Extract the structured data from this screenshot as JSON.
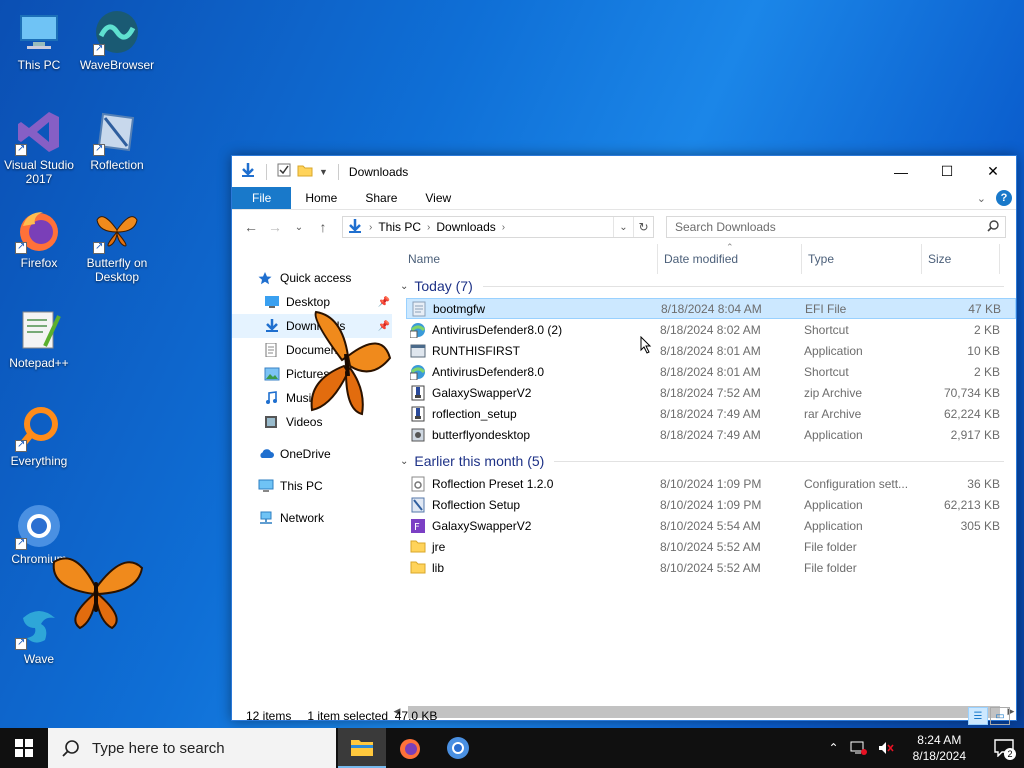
{
  "desktop": {
    "icons": [
      {
        "label": "This PC"
      },
      {
        "label": "WaveBrowser"
      },
      {
        "label": "Visual Studio 2017"
      },
      {
        "label": "Roflection"
      },
      {
        "label": "Firefox"
      },
      {
        "label": "Butterfly on Desktop"
      },
      {
        "label": "Notepad++"
      },
      {
        "label": "Everything"
      },
      {
        "label": "Chromium"
      },
      {
        "label": "Wave"
      }
    ]
  },
  "window": {
    "title": "Downloads",
    "ribbon": {
      "file": "File",
      "home": "Home",
      "share": "Share",
      "view": "View"
    },
    "address": {
      "root": "This PC",
      "folder": "Downloads"
    },
    "search_placeholder": "Search Downloads",
    "nav": {
      "quick_access": "Quick access",
      "desktop": "Desktop",
      "downloads": "Downloads",
      "documents": "Documents",
      "pictures": "Pictures",
      "music": "Music",
      "videos": "Videos",
      "onedrive": "OneDrive",
      "this_pc": "This PC",
      "network": "Network"
    },
    "columns": {
      "name": "Name",
      "date": "Date modified",
      "type": "Type",
      "size": "Size"
    },
    "groups": [
      {
        "label": "Today (7)",
        "rows": [
          {
            "name": "bootmgfw",
            "date": "8/18/2024 8:04 AM",
            "type": "EFI File",
            "size": "47 KB",
            "icon": "efi-file-icon"
          },
          {
            "name": "AntivirusDefender8.0 (2)",
            "date": "8/18/2024 8:02 AM",
            "type": "Shortcut",
            "size": "2 KB",
            "icon": "shortcut-icon"
          },
          {
            "name": "RUNTHISFIRST",
            "date": "8/18/2024 8:01 AM",
            "type": "Application",
            "size": "10 KB",
            "icon": "application-icon"
          },
          {
            "name": "AntivirusDefender8.0",
            "date": "8/18/2024 8:01 AM",
            "type": "Shortcut",
            "size": "2 KB",
            "icon": "shortcut-icon"
          },
          {
            "name": "GalaxySwapperV2",
            "date": "8/18/2024 7:52 AM",
            "type": "zip Archive",
            "size": "70,734 KB",
            "icon": "archive-icon"
          },
          {
            "name": "roflection_setup",
            "date": "8/18/2024 7:49 AM",
            "type": "rar Archive",
            "size": "62,224 KB",
            "icon": "archive-icon"
          },
          {
            "name": "butterflyondesktop",
            "date": "8/18/2024 7:49 AM",
            "type": "Application",
            "size": "2,917 KB",
            "icon": "installer-icon"
          }
        ]
      },
      {
        "label": "Earlier this month (5)",
        "rows": [
          {
            "name": "Roflection Preset 1.2.0",
            "date": "8/10/2024 1:09 PM",
            "type": "Configuration sett...",
            "size": "36 KB",
            "icon": "config-file-icon"
          },
          {
            "name": "Roflection Setup",
            "date": "8/10/2024 1:09 PM",
            "type": "Application",
            "size": "62,213 KB",
            "icon": "setup-icon"
          },
          {
            "name": "GalaxySwapperV2",
            "date": "8/10/2024 5:54 AM",
            "type": "Application",
            "size": "305 KB",
            "icon": "galaxy-app-icon"
          },
          {
            "name": "jre",
            "date": "8/10/2024 5:52 AM",
            "type": "File folder",
            "size": "",
            "icon": "folder-icon"
          },
          {
            "name": "lib",
            "date": "8/10/2024 5:52 AM",
            "type": "File folder",
            "size": "",
            "icon": "folder-icon"
          }
        ]
      }
    ],
    "status": {
      "count": "12 items",
      "selection": "1 item selected  47.0 KB"
    }
  },
  "taskbar": {
    "search_placeholder": "Type here to search",
    "time": "8:24 AM",
    "date": "8/18/2024",
    "notifications": "2"
  },
  "colors": {
    "accent": "#1979ca",
    "selection": "#cce8ff",
    "desktop": "#0f6fd6",
    "taskbar": "#101010"
  }
}
